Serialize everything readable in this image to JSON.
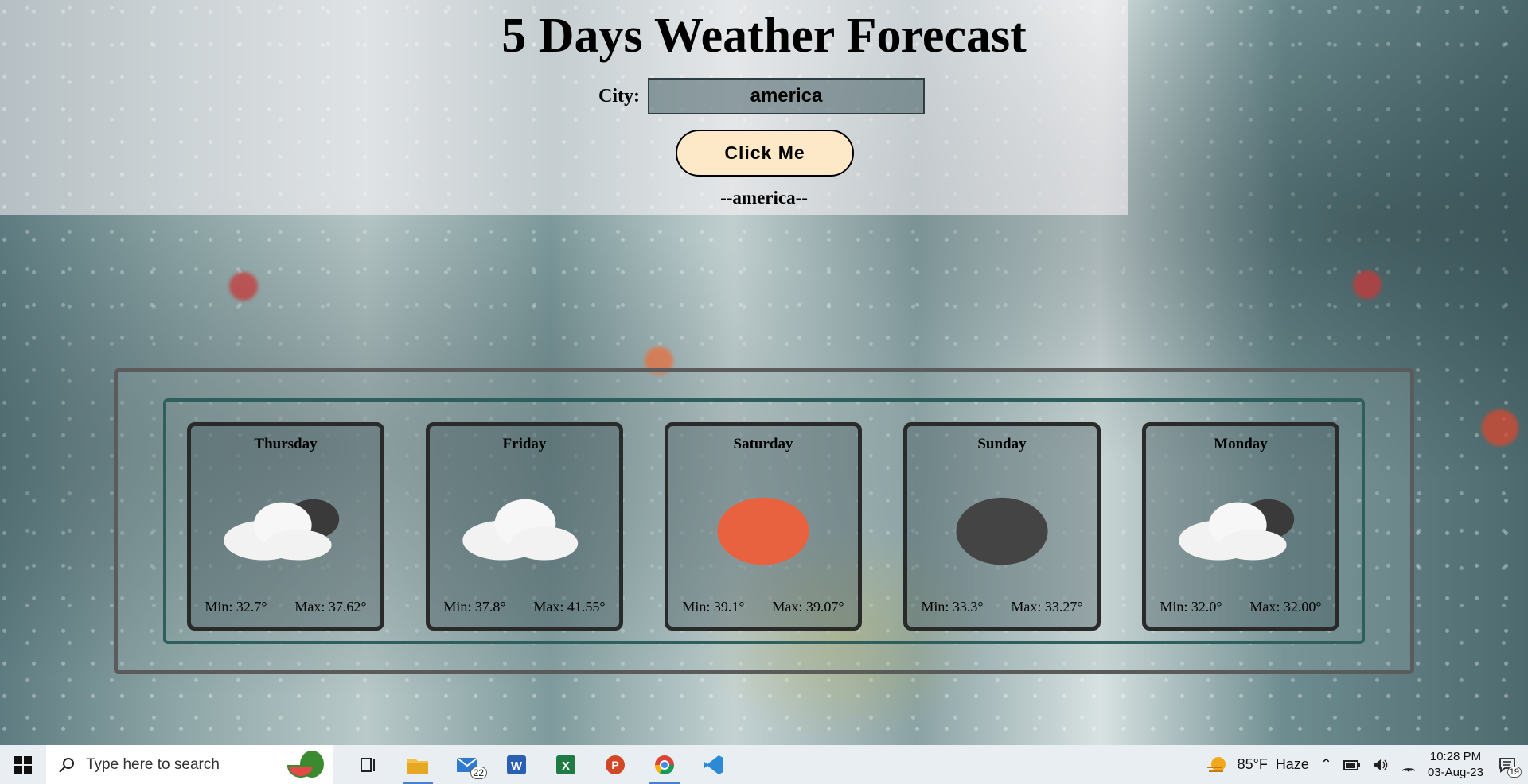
{
  "page": {
    "title": "5 Days Weather Forecast",
    "city_label": "City:",
    "city_value": "america",
    "button_label": "Click Me",
    "city_echo": "--america--"
  },
  "forecast": [
    {
      "day": "Thursday",
      "min": "Min: 32.7°",
      "max": "Max: 37.62°",
      "icon": "partly-cloudy-icon"
    },
    {
      "day": "Friday",
      "min": "Min: 37.8°",
      "max": "Max: 41.55°",
      "icon": "cloud-icon"
    },
    {
      "day": "Saturday",
      "min": "Min: 39.1°",
      "max": "Max: 39.07°",
      "icon": "sun-icon"
    },
    {
      "day": "Sunday",
      "min": "Min: 33.3°",
      "max": "Max: 33.27°",
      "icon": "moon-icon"
    },
    {
      "day": "Monday",
      "min": "Min: 32.0°",
      "max": "Max: 32.00°",
      "icon": "partly-cloudy-icon"
    }
  ],
  "taskbar": {
    "search_placeholder": "Type here to search",
    "mail_badge": "22",
    "weather_temp": "85°F",
    "weather_condition": "Haze",
    "time": "10:28 PM",
    "date": "03-Aug-23",
    "notification_count": "19"
  },
  "colors": {
    "button_bg": "#fde9c8",
    "frame_outer": "#5b5b5b",
    "frame_inner": "#2f5f5c",
    "sun": "#e8623f",
    "moon": "#444444"
  }
}
